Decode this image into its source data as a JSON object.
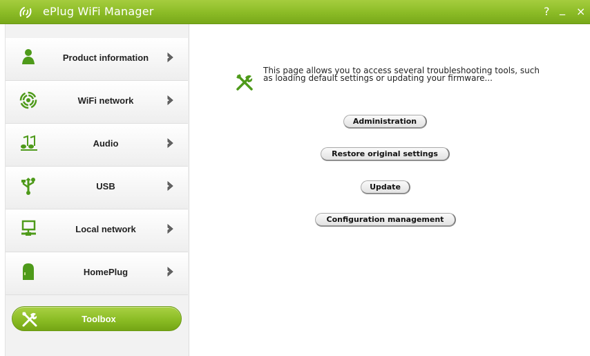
{
  "window": {
    "title": "ePlug WiFi Manager",
    "help_label": "?",
    "minimize_label": "_",
    "close_label": "×"
  },
  "colors": {
    "brand_green": "#8bbb26",
    "sidebar_bg": "#f2f2f2",
    "icon_green": "#4e9a1a"
  },
  "sidebar": {
    "items": [
      {
        "label": "Product information",
        "icon": "person-icon"
      },
      {
        "label": "WiFi network",
        "icon": "wifi-icon"
      },
      {
        "label": "Audio",
        "icon": "music-notes-icon"
      },
      {
        "label": "USB",
        "icon": "usb-icon"
      },
      {
        "label": "Local network",
        "icon": "computer-network-icon"
      },
      {
        "label": "HomePlug",
        "icon": "homeplug-icon"
      }
    ],
    "active": {
      "label": "Toolbox",
      "icon": "tools-icon"
    }
  },
  "main": {
    "description": "This page allows you to access several troubleshooting tools, such as loading default settings or updating your firmware...",
    "buttons": {
      "administration": "Administration",
      "restore": "Restore original settings",
      "update": "Update",
      "configuration": "Configuration management"
    }
  }
}
